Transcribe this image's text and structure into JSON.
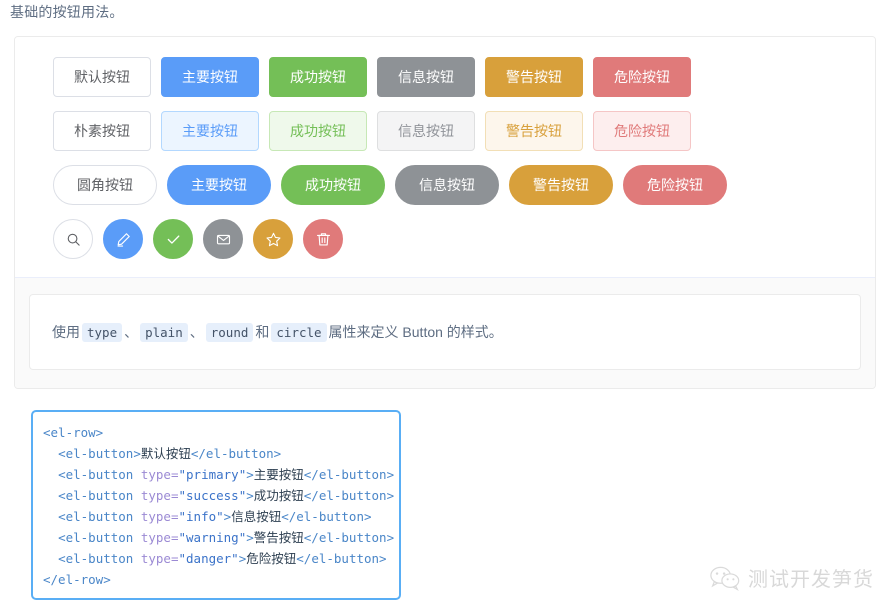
{
  "intro": {
    "text": "基础的按钮用法。"
  },
  "demo": {
    "rows": [
      {
        "name": "default-row",
        "buttons": [
          {
            "label": "默认按钮",
            "type": "default"
          },
          {
            "label": "主要按钮",
            "type": "primary"
          },
          {
            "label": "成功按钮",
            "type": "success"
          },
          {
            "label": "信息按钮",
            "type": "info"
          },
          {
            "label": "警告按钮",
            "type": "warning"
          },
          {
            "label": "危险按钮",
            "type": "danger"
          }
        ]
      },
      {
        "name": "plain-row",
        "buttons": [
          {
            "label": "朴素按钮",
            "type": "default"
          },
          {
            "label": "主要按钮",
            "type": "primary"
          },
          {
            "label": "成功按钮",
            "type": "success"
          },
          {
            "label": "信息按钮",
            "type": "info"
          },
          {
            "label": "警告按钮",
            "type": "warning"
          },
          {
            "label": "危险按钮",
            "type": "danger"
          }
        ]
      },
      {
        "name": "round-row",
        "buttons": [
          {
            "label": "圆角按钮",
            "type": "default"
          },
          {
            "label": "主要按钮",
            "type": "primary"
          },
          {
            "label": "成功按钮",
            "type": "success"
          },
          {
            "label": "信息按钮",
            "type": "info"
          },
          {
            "label": "警告按钮",
            "type": "warning"
          },
          {
            "label": "危险按钮",
            "type": "danger"
          }
        ]
      },
      {
        "name": "circle-row",
        "buttons": [
          {
            "icon": "search-icon",
            "type": "default"
          },
          {
            "icon": "edit-icon",
            "type": "primary"
          },
          {
            "icon": "check-icon",
            "type": "success"
          },
          {
            "icon": "message-icon",
            "type": "info"
          },
          {
            "icon": "star-icon",
            "type": "warning"
          },
          {
            "icon": "delete-icon",
            "type": "danger"
          }
        ]
      }
    ]
  },
  "tip": {
    "lead": "使用",
    "code1": "type",
    "sep1": "、",
    "code2": "plain",
    "sep2": "、",
    "code3": "round",
    "conj": "和",
    "code4": "circle",
    "tail": "属性来定义 Button 的样式。"
  },
  "code": {
    "lines": [
      [
        {
          "t": "tag",
          "s": "<el-row>"
        }
      ],
      [
        {
          "t": "plain",
          "s": "  "
        },
        {
          "t": "tag",
          "s": "<el-button>"
        },
        {
          "t": "text",
          "s": "默认按钮"
        },
        {
          "t": "tag",
          "s": "</el-button>"
        }
      ],
      [
        {
          "t": "plain",
          "s": "  "
        },
        {
          "t": "tag",
          "s": "<el-button "
        },
        {
          "t": "attr",
          "s": "type="
        },
        {
          "t": "val",
          "s": "\"primary\""
        },
        {
          "t": "tag",
          "s": ">"
        },
        {
          "t": "text",
          "s": "主要按钮"
        },
        {
          "t": "tag",
          "s": "</el-button>"
        }
      ],
      [
        {
          "t": "plain",
          "s": "  "
        },
        {
          "t": "tag",
          "s": "<el-button "
        },
        {
          "t": "attr",
          "s": "type="
        },
        {
          "t": "val",
          "s": "\"success\""
        },
        {
          "t": "tag",
          "s": ">"
        },
        {
          "t": "text",
          "s": "成功按钮"
        },
        {
          "t": "tag",
          "s": "</el-button>"
        }
      ],
      [
        {
          "t": "plain",
          "s": "  "
        },
        {
          "t": "tag",
          "s": "<el-button "
        },
        {
          "t": "attr",
          "s": "type="
        },
        {
          "t": "val",
          "s": "\"info\""
        },
        {
          "t": "tag",
          "s": ">"
        },
        {
          "t": "text",
          "s": "信息按钮"
        },
        {
          "t": "tag",
          "s": "</el-button>"
        }
      ],
      [
        {
          "t": "plain",
          "s": "  "
        },
        {
          "t": "tag",
          "s": "<el-button "
        },
        {
          "t": "attr",
          "s": "type="
        },
        {
          "t": "val",
          "s": "\"warning\""
        },
        {
          "t": "tag",
          "s": ">"
        },
        {
          "t": "text",
          "s": "警告按钮"
        },
        {
          "t": "tag",
          "s": "</el-button>"
        }
      ],
      [
        {
          "t": "plain",
          "s": "  "
        },
        {
          "t": "tag",
          "s": "<el-button "
        },
        {
          "t": "attr",
          "s": "type="
        },
        {
          "t": "val",
          "s": "\"danger\""
        },
        {
          "t": "tag",
          "s": ">"
        },
        {
          "t": "text",
          "s": "危险按钮"
        },
        {
          "t": "tag",
          "s": "</el-button>"
        }
      ],
      [
        {
          "t": "tag",
          "s": "</el-row>"
        }
      ]
    ]
  },
  "watermark": {
    "text": "测试开发笋货",
    "icon": "wechat-icon"
  },
  "colors": {
    "primary": "#5a9cf8",
    "success": "#74bf57",
    "info": "#8e9296",
    "warning": "#d8a03b",
    "danger": "#e07a7a",
    "code_border": "#59aef5",
    "text": "#5e6d82"
  }
}
